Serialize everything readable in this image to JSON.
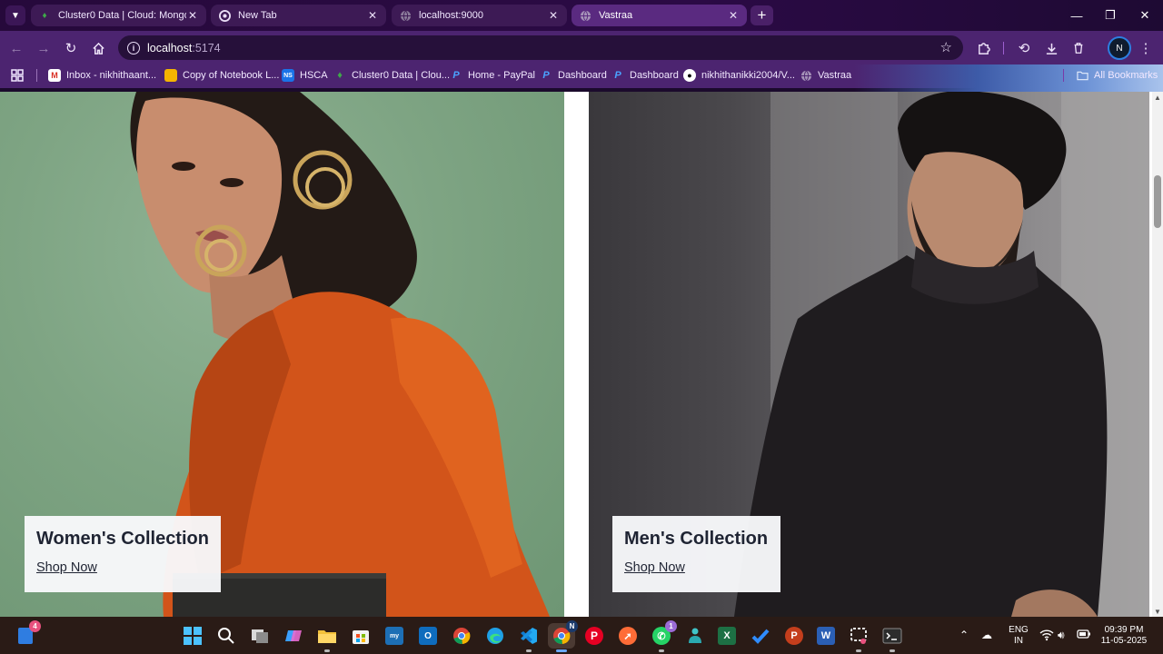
{
  "browser": {
    "tabs": [
      {
        "title": "Cluster0 Data | Cloud: MongoDB",
        "icon": "mongodb-leaf-icon",
        "active": false
      },
      {
        "title": "New Tab",
        "icon": "chrome-icon",
        "active": false
      },
      {
        "title": "localhost:9000",
        "icon": "globe-icon",
        "active": false
      },
      {
        "title": "Vastraa",
        "icon": "globe-icon",
        "active": true
      }
    ],
    "address_bar": {
      "host": "localhost",
      "port": ":5174"
    },
    "profile_initial": "N",
    "bookmarks": [
      {
        "label": "Inbox - nikhithaant...",
        "icon": "gmail-icon"
      },
      {
        "label": "Copy of Notebook L...",
        "icon": "slides-icon"
      },
      {
        "label": "HSCA",
        "icon": "ns-icon"
      },
      {
        "label": "Cluster0 Data | Clou...",
        "icon": "mongodb-leaf-icon"
      },
      {
        "label": "Home - PayPal",
        "icon": "paypal-icon"
      },
      {
        "label": "Dashboard",
        "icon": "paypal-icon"
      },
      {
        "label": "Dashboard",
        "icon": "paypal-icon"
      },
      {
        "label": "nikhithanikki2004/V...",
        "icon": "github-icon"
      },
      {
        "label": "Vastraa",
        "icon": "globe-icon"
      }
    ],
    "all_bookmarks_label": "All Bookmarks"
  },
  "page": {
    "collections": [
      {
        "title": "Women's Collection",
        "link": "Shop Now"
      },
      {
        "title": "Men's Collection",
        "link": "Shop Now"
      }
    ]
  },
  "taskbar": {
    "widgets_badge": "4",
    "whatsapp_badge": "1",
    "language_line1": "ENG",
    "language_line2": "IN",
    "time": "09:39 PM",
    "date": "11-05-2025"
  },
  "colors": {
    "tab_strip": "#2b0a45",
    "toolbar": "#4c2470",
    "women_bg": "#7ea483",
    "men_bg": "#4a484c",
    "orange_outfit": "#d2541a",
    "caption_text": "#1f2433"
  }
}
